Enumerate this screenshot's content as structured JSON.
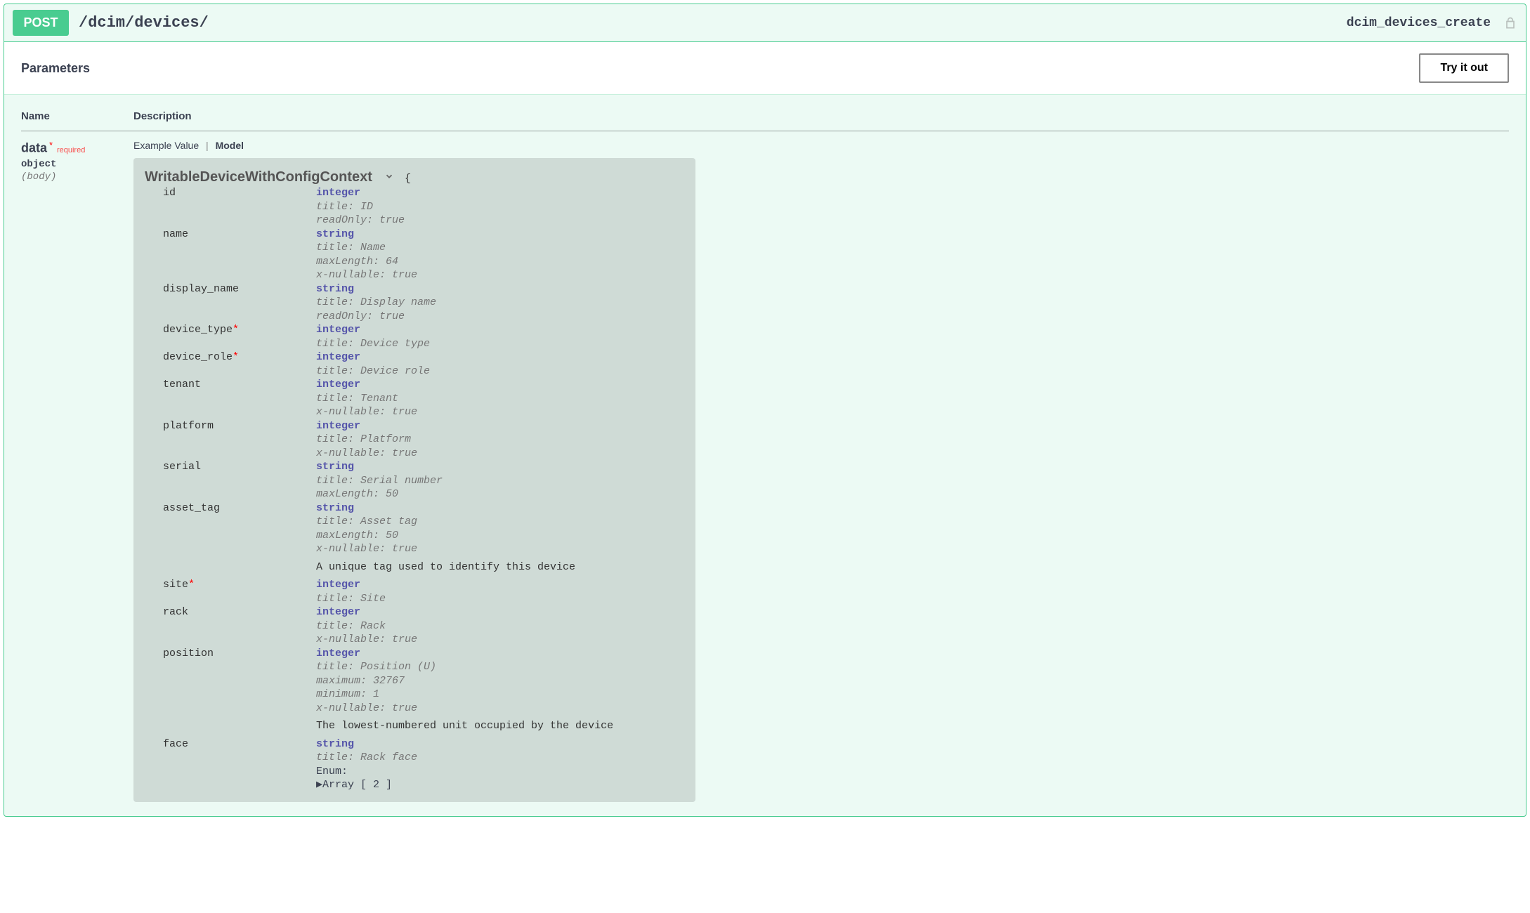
{
  "summary": {
    "method": "POST",
    "path": "/dcim/devices/",
    "operation_id": "dcim_devices_create"
  },
  "params_header": {
    "title": "Parameters",
    "try_label": "Try it out"
  },
  "columns": {
    "name": "Name",
    "description": "Description"
  },
  "param": {
    "name": "data",
    "required_label": "required",
    "type": "object",
    "in": "(body)"
  },
  "tabs": {
    "example": "Example Value",
    "model": "Model"
  },
  "model": {
    "title": "WritableDeviceWithConfigContext",
    "open_brace": "{",
    "properties": [
      {
        "name": "id",
        "required": false,
        "type": "integer",
        "meta": [
          "title: ID",
          "readOnly: true"
        ]
      },
      {
        "name": "name",
        "required": false,
        "type": "string",
        "meta": [
          "title: Name",
          "maxLength: 64",
          "x-nullable: true"
        ]
      },
      {
        "name": "display_name",
        "required": false,
        "type": "string",
        "meta": [
          "title: Display name",
          "readOnly: true"
        ]
      },
      {
        "name": "device_type",
        "required": true,
        "type": "integer",
        "meta": [
          "title: Device type"
        ]
      },
      {
        "name": "device_role",
        "required": true,
        "type": "integer",
        "meta": [
          "title: Device role"
        ]
      },
      {
        "name": "tenant",
        "required": false,
        "type": "integer",
        "meta": [
          "title: Tenant",
          "x-nullable: true"
        ]
      },
      {
        "name": "platform",
        "required": false,
        "type": "integer",
        "meta": [
          "title: Platform",
          "x-nullable: true"
        ]
      },
      {
        "name": "serial",
        "required": false,
        "type": "string",
        "meta": [
          "title: Serial number",
          "maxLength: 50"
        ]
      },
      {
        "name": "asset_tag",
        "required": false,
        "type": "string",
        "meta": [
          "title: Asset tag",
          "maxLength: 50",
          "x-nullable: true"
        ],
        "description": "A unique tag used to identify this device"
      },
      {
        "name": "site",
        "required": true,
        "type": "integer",
        "meta": [
          "title: Site"
        ]
      },
      {
        "name": "rack",
        "required": false,
        "type": "integer",
        "meta": [
          "title: Rack",
          "x-nullable: true"
        ]
      },
      {
        "name": "position",
        "required": false,
        "type": "integer",
        "meta": [
          "title: Position (U)",
          "maximum: 32767",
          "minimum: 1",
          "x-nullable: true"
        ],
        "description": "The lowest-numbered unit occupied by the device"
      },
      {
        "name": "face",
        "required": false,
        "type": "string",
        "meta": [
          "title: Rack face"
        ],
        "enum_label": "Enum:",
        "enum_collapsed": "Array [ 2 ]"
      }
    ]
  }
}
